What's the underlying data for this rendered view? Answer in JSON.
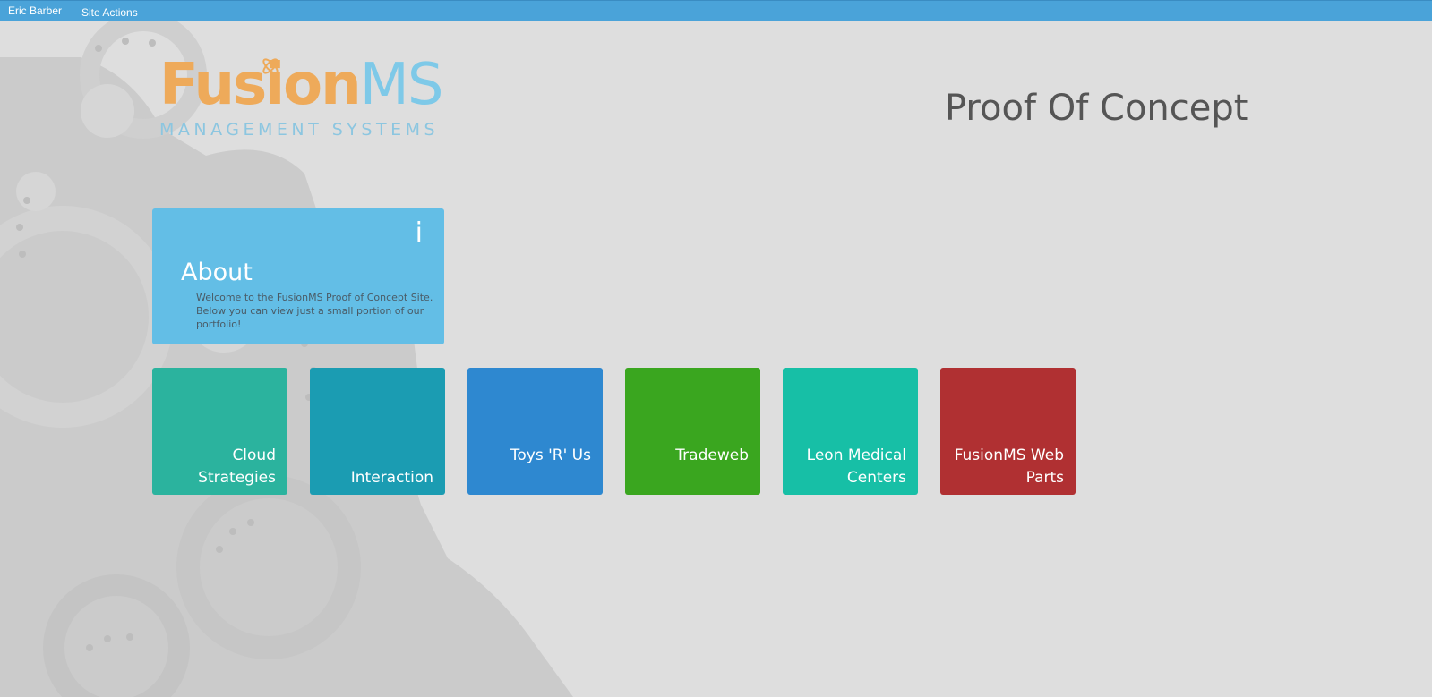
{
  "topbar": {
    "user_name": "Eric Barber",
    "site_actions_label": "Site Actions"
  },
  "logo": {
    "fusion_text": "Fusion",
    "ms_text": "MS",
    "subtitle": "MANAGEMENT SYSTEMS",
    "colors": {
      "fusion": "#eeaa5a",
      "ms": "#7ec9e8"
    }
  },
  "page_title": "Proof Of Concept",
  "about": {
    "icon": "info-icon",
    "icon_glyph": "i",
    "heading": "About",
    "text": "Welcome to the FusionMS Proof of Concept Site. Below you can view just a small portion of our portfolio!",
    "color": "#63bee6"
  },
  "tiles": [
    {
      "label": "Cloud Strategies",
      "color": "#2bb39e"
    },
    {
      "label": "Interaction",
      "color": "#1b9cb2"
    },
    {
      "label": "Toys 'R' Us",
      "color": "#2e88d0"
    },
    {
      "label": "Tradeweb",
      "color": "#3aa61f"
    },
    {
      "label": "Leon Medical Centers",
      "color": "#17bfa6"
    },
    {
      "label": "FusionMS Web Parts",
      "color": "#b03032"
    }
  ],
  "colors": {
    "topbar": "#4aa3d9",
    "background": "#dedede",
    "gears": "#c9c9c9"
  }
}
